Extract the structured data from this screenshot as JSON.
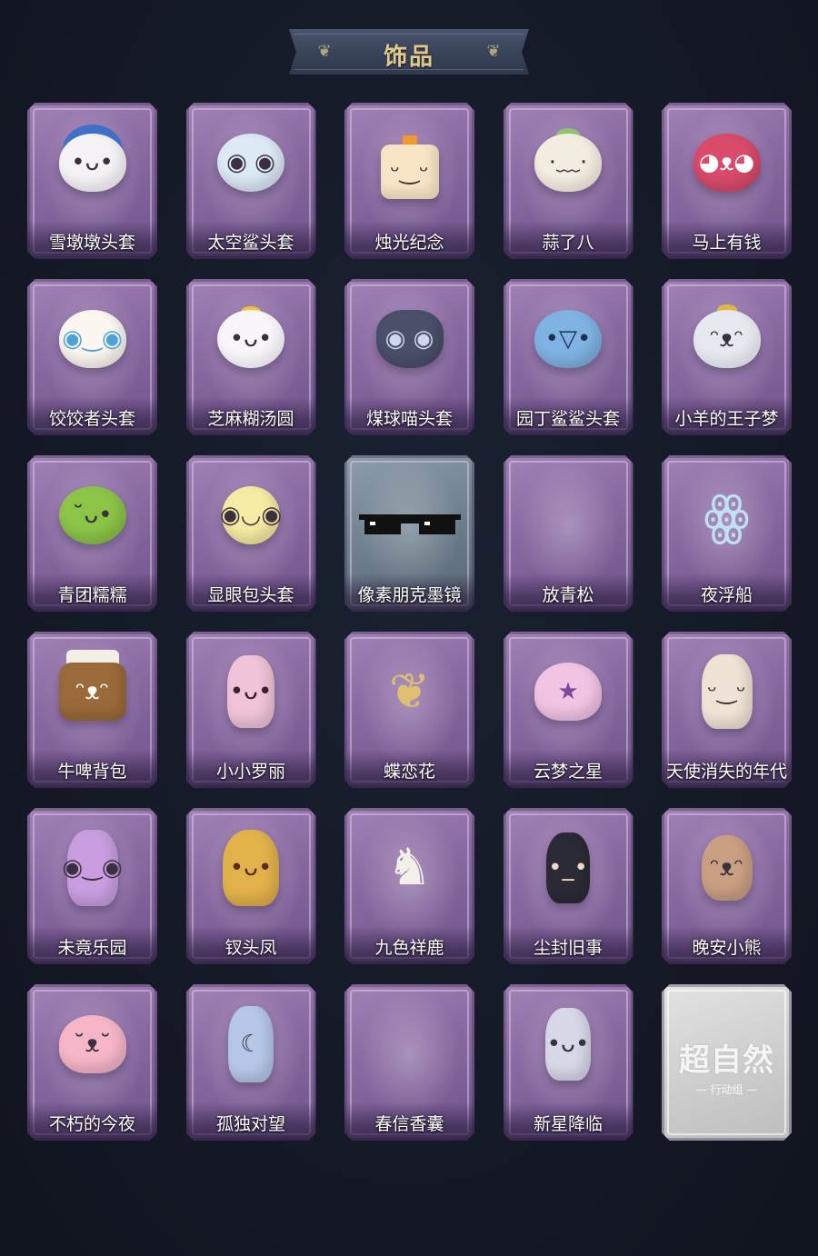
{
  "header": {
    "title": "饰品"
  },
  "items": [
    {
      "name": "雪墩墩头套",
      "icon": "snowman-deer-head-icon",
      "color": "#f4f2f5"
    },
    {
      "name": "太空鲨头套",
      "icon": "space-shark-head-icon",
      "color": "#dce8f5"
    },
    {
      "name": "烛光纪念",
      "icon": "candle-icon",
      "color": "#f9e4c5"
    },
    {
      "name": "蒜了八",
      "icon": "garlic-icon",
      "color": "#f3ece0"
    },
    {
      "name": "马上有钱",
      "icon": "horse-head-icon",
      "color": "#d94a6b"
    },
    {
      "name": "饺饺者头套",
      "icon": "dumpling-head-icon",
      "color": "#fbf6ef"
    },
    {
      "name": "芝麻糊汤圆",
      "icon": "rice-ball-icon",
      "color": "#f8f6fa"
    },
    {
      "name": "煤球喵头套",
      "icon": "black-cat-head-icon",
      "color": "#4a4f6a"
    },
    {
      "name": "园丁鲨鲨头套",
      "icon": "gardener-shark-icon",
      "color": "#7fb3e3"
    },
    {
      "name": "小羊的王子梦",
      "icon": "sheep-prince-icon",
      "color": "#e7e9f1"
    },
    {
      "name": "青团糯糯",
      "icon": "green-rice-ball-icon",
      "color": "#8cc447"
    },
    {
      "name": "显眼包头套",
      "icon": "lightbulb-head-icon",
      "color": "#f5eba2"
    },
    {
      "name": "像素朋克墨镜",
      "icon": "pixel-sunglasses-icon",
      "color": "#111111"
    },
    {
      "name": "放青松",
      "icon": "empty-slot-icon",
      "color": ""
    },
    {
      "name": "夜浮船",
      "icon": "jellyfish-icon",
      "color": "#a8d2ef"
    },
    {
      "name": "牛啤背包",
      "icon": "beer-cow-backpack-icon",
      "color": "#9a6a3a"
    },
    {
      "name": "小小罗丽",
      "icon": "doll-icon",
      "color": "#f0c3d8"
    },
    {
      "name": "蝶恋花",
      "icon": "butterfly-bell-icon",
      "color": "#d7b46a"
    },
    {
      "name": "云梦之星",
      "icon": "unicorn-cloud-icon",
      "color": "#f2c4e4"
    },
    {
      "name": "天使消失的年代",
      "icon": "angel-girl-icon",
      "color": "#efe3d5"
    },
    {
      "name": "未竟乐园",
      "icon": "clown-girl-icon",
      "color": "#c99ee0"
    },
    {
      "name": "钗头凤",
      "icon": "phoenix-crown-icon",
      "color": "#e2b24a"
    },
    {
      "name": "九色祥鹿",
      "icon": "deer-pendant-icon",
      "color": "#f3f0ea"
    },
    {
      "name": "尘封旧事",
      "icon": "boy-pendant-icon",
      "color": "#2b2b36"
    },
    {
      "name": "晚安小熊",
      "icon": "bear-pendant-icon",
      "color": "#caa083"
    },
    {
      "name": "不朽的今夜",
      "icon": "pink-fox-icon",
      "color": "#f6b6c8"
    },
    {
      "name": "孤独对望",
      "icon": "moon-pendant-icon",
      "color": "#b6c7e8"
    },
    {
      "name": "春信香囊",
      "icon": "empty-slot-icon",
      "color": ""
    },
    {
      "name": "新星降临",
      "icon": "star-boy-icon",
      "color": "#d7d9e8"
    }
  ],
  "placeholder": {
    "logo_main": "超自然",
    "logo_sub": "— 行动组 —"
  }
}
